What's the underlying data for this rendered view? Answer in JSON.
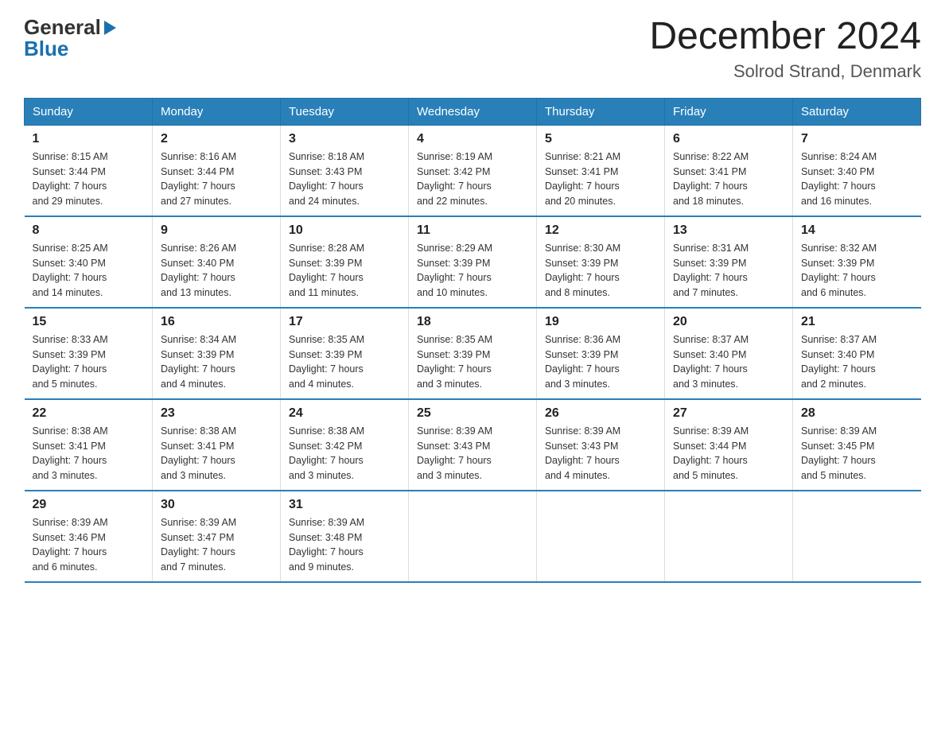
{
  "logo": {
    "text_general": "General",
    "text_blue": "Blue"
  },
  "title": "December 2024",
  "subtitle": "Solrod Strand, Denmark",
  "days_of_week": [
    "Sunday",
    "Monday",
    "Tuesday",
    "Wednesday",
    "Thursday",
    "Friday",
    "Saturday"
  ],
  "weeks": [
    [
      {
        "day": "1",
        "sunrise": "Sunrise: 8:15 AM",
        "sunset": "Sunset: 3:44 PM",
        "daylight": "Daylight: 7 hours and 29 minutes."
      },
      {
        "day": "2",
        "sunrise": "Sunrise: 8:16 AM",
        "sunset": "Sunset: 3:44 PM",
        "daylight": "Daylight: 7 hours and 27 minutes."
      },
      {
        "day": "3",
        "sunrise": "Sunrise: 8:18 AM",
        "sunset": "Sunset: 3:43 PM",
        "daylight": "Daylight: 7 hours and 24 minutes."
      },
      {
        "day": "4",
        "sunrise": "Sunrise: 8:19 AM",
        "sunset": "Sunset: 3:42 PM",
        "daylight": "Daylight: 7 hours and 22 minutes."
      },
      {
        "day": "5",
        "sunrise": "Sunrise: 8:21 AM",
        "sunset": "Sunset: 3:41 PM",
        "daylight": "Daylight: 7 hours and 20 minutes."
      },
      {
        "day": "6",
        "sunrise": "Sunrise: 8:22 AM",
        "sunset": "Sunset: 3:41 PM",
        "daylight": "Daylight: 7 hours and 18 minutes."
      },
      {
        "day": "7",
        "sunrise": "Sunrise: 8:24 AM",
        "sunset": "Sunset: 3:40 PM",
        "daylight": "Daylight: 7 hours and 16 minutes."
      }
    ],
    [
      {
        "day": "8",
        "sunrise": "Sunrise: 8:25 AM",
        "sunset": "Sunset: 3:40 PM",
        "daylight": "Daylight: 7 hours and 14 minutes."
      },
      {
        "day": "9",
        "sunrise": "Sunrise: 8:26 AM",
        "sunset": "Sunset: 3:40 PM",
        "daylight": "Daylight: 7 hours and 13 minutes."
      },
      {
        "day": "10",
        "sunrise": "Sunrise: 8:28 AM",
        "sunset": "Sunset: 3:39 PM",
        "daylight": "Daylight: 7 hours and 11 minutes."
      },
      {
        "day": "11",
        "sunrise": "Sunrise: 8:29 AM",
        "sunset": "Sunset: 3:39 PM",
        "daylight": "Daylight: 7 hours and 10 minutes."
      },
      {
        "day": "12",
        "sunrise": "Sunrise: 8:30 AM",
        "sunset": "Sunset: 3:39 PM",
        "daylight": "Daylight: 7 hours and 8 minutes."
      },
      {
        "day": "13",
        "sunrise": "Sunrise: 8:31 AM",
        "sunset": "Sunset: 3:39 PM",
        "daylight": "Daylight: 7 hours and 7 minutes."
      },
      {
        "day": "14",
        "sunrise": "Sunrise: 8:32 AM",
        "sunset": "Sunset: 3:39 PM",
        "daylight": "Daylight: 7 hours and 6 minutes."
      }
    ],
    [
      {
        "day": "15",
        "sunrise": "Sunrise: 8:33 AM",
        "sunset": "Sunset: 3:39 PM",
        "daylight": "Daylight: 7 hours and 5 minutes."
      },
      {
        "day": "16",
        "sunrise": "Sunrise: 8:34 AM",
        "sunset": "Sunset: 3:39 PM",
        "daylight": "Daylight: 7 hours and 4 minutes."
      },
      {
        "day": "17",
        "sunrise": "Sunrise: 8:35 AM",
        "sunset": "Sunset: 3:39 PM",
        "daylight": "Daylight: 7 hours and 4 minutes."
      },
      {
        "day": "18",
        "sunrise": "Sunrise: 8:35 AM",
        "sunset": "Sunset: 3:39 PM",
        "daylight": "Daylight: 7 hours and 3 minutes."
      },
      {
        "day": "19",
        "sunrise": "Sunrise: 8:36 AM",
        "sunset": "Sunset: 3:39 PM",
        "daylight": "Daylight: 7 hours and 3 minutes."
      },
      {
        "day": "20",
        "sunrise": "Sunrise: 8:37 AM",
        "sunset": "Sunset: 3:40 PM",
        "daylight": "Daylight: 7 hours and 3 minutes."
      },
      {
        "day": "21",
        "sunrise": "Sunrise: 8:37 AM",
        "sunset": "Sunset: 3:40 PM",
        "daylight": "Daylight: 7 hours and 2 minutes."
      }
    ],
    [
      {
        "day": "22",
        "sunrise": "Sunrise: 8:38 AM",
        "sunset": "Sunset: 3:41 PM",
        "daylight": "Daylight: 7 hours and 3 minutes."
      },
      {
        "day": "23",
        "sunrise": "Sunrise: 8:38 AM",
        "sunset": "Sunset: 3:41 PM",
        "daylight": "Daylight: 7 hours and 3 minutes."
      },
      {
        "day": "24",
        "sunrise": "Sunrise: 8:38 AM",
        "sunset": "Sunset: 3:42 PM",
        "daylight": "Daylight: 7 hours and 3 minutes."
      },
      {
        "day": "25",
        "sunrise": "Sunrise: 8:39 AM",
        "sunset": "Sunset: 3:43 PM",
        "daylight": "Daylight: 7 hours and 3 minutes."
      },
      {
        "day": "26",
        "sunrise": "Sunrise: 8:39 AM",
        "sunset": "Sunset: 3:43 PM",
        "daylight": "Daylight: 7 hours and 4 minutes."
      },
      {
        "day": "27",
        "sunrise": "Sunrise: 8:39 AM",
        "sunset": "Sunset: 3:44 PM",
        "daylight": "Daylight: 7 hours and 5 minutes."
      },
      {
        "day": "28",
        "sunrise": "Sunrise: 8:39 AM",
        "sunset": "Sunset: 3:45 PM",
        "daylight": "Daylight: 7 hours and 5 minutes."
      }
    ],
    [
      {
        "day": "29",
        "sunrise": "Sunrise: 8:39 AM",
        "sunset": "Sunset: 3:46 PM",
        "daylight": "Daylight: 7 hours and 6 minutes."
      },
      {
        "day": "30",
        "sunrise": "Sunrise: 8:39 AM",
        "sunset": "Sunset: 3:47 PM",
        "daylight": "Daylight: 7 hours and 7 minutes."
      },
      {
        "day": "31",
        "sunrise": "Sunrise: 8:39 AM",
        "sunset": "Sunset: 3:48 PM",
        "daylight": "Daylight: 7 hours and 9 minutes."
      },
      null,
      null,
      null,
      null
    ]
  ]
}
